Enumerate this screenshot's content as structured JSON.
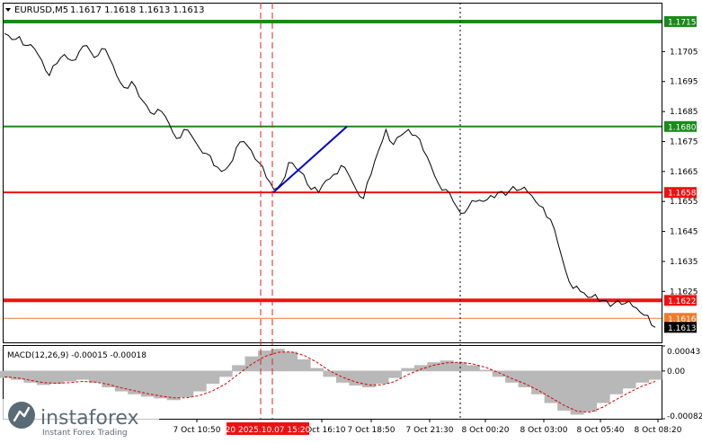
{
  "header": {
    "symbol_label": "EURUSD,M5",
    "ohlc_text": "1.1617 1.1618 1.1613 1.1613"
  },
  "macd_panel": {
    "label": "MACD(12,26,9) -0.00015 -0.00018"
  },
  "watermark": {
    "brand": "instaforex",
    "tagline": "Instant Forex Trading"
  },
  "colors": {
    "price_line": "#000000",
    "green_level": "#1a8a1a",
    "red_level": "#ee1111",
    "orange_level": "#f07a2a",
    "trend_line": "#0000cc",
    "histogram": "#b8b8b8",
    "signal_line": "#dd0000",
    "grid": "#cfcfcf"
  },
  "chart_data": [
    {
      "type": "line",
      "title": "EURUSD,M5",
      "ylim": [
        1.1608,
        1.1721
      ],
      "y_ticks": [
        "1.1705",
        "1.1695",
        "1.1685",
        "1.1675",
        "1.1665",
        "1.1655",
        "1.1645",
        "1.1635",
        "1.1625"
      ],
      "x_tick_labels": [
        "7 Oct 10:50",
        "7 Oct 16:10",
        "7 Oct 18:50",
        "7 Oct 21:30",
        "8 Oct 00:20",
        "8 Oct 03:00",
        "8 Oct 05:40",
        "8 Oct 08:20"
      ],
      "highlighted_time_label": "20 2025.10.07 15:20",
      "series": [
        {
          "values": [
            1.1711,
            1.1709,
            1.171,
            1.1707,
            1.1706,
            1.1702,
            1.1697,
            1.1701,
            1.1704,
            1.1702,
            1.1705,
            1.1707,
            1.1703,
            1.1706,
            1.1703,
            1.1697,
            1.1693,
            1.1695,
            1.169,
            1.1687,
            1.1684,
            1.1685,
            1.1681,
            1.1676,
            1.1679,
            1.1677,
            1.1673,
            1.1671,
            1.1667,
            1.1665,
            1.1667,
            1.1673,
            1.1675,
            1.1672,
            1.1668,
            1.1663,
            1.1659,
            1.1661,
            1.1668,
            1.1666,
            1.1664,
            1.1659,
            1.1658,
            1.1662,
            1.1664,
            1.1667,
            1.1664,
            1.1659,
            1.1656,
            1.1664,
            1.1672,
            1.1679,
            1.1674,
            1.1677,
            1.1679,
            1.1677,
            1.1672,
            1.1667,
            1.1661,
            1.1659,
            1.1655,
            1.1651,
            1.1653,
            1.1655,
            1.1655,
            1.1657,
            1.1658,
            1.1657,
            1.166,
            1.1659,
            1.1658,
            1.1655,
            1.1653,
            1.1649,
            1.1641,
            1.1632,
            1.1626,
            1.1625,
            1.1623,
            1.1624,
            1.1622,
            1.162,
            1.1622,
            1.1621,
            1.162,
            1.1618,
            1.1617,
            1.1613
          ]
        }
      ],
      "horizontal_levels": [
        {
          "label": "1.1715",
          "value": 1.1715,
          "color": "green"
        },
        {
          "label": "1.1680",
          "value": 1.168,
          "color": "green"
        },
        {
          "label": "1.1658",
          "value": 1.1658,
          "color": "red"
        },
        {
          "label": "1.1622",
          "value": 1.1622,
          "color": "red"
        },
        {
          "label": "1.1616",
          "value": 1.1616,
          "color": "orange"
        },
        {
          "label": "1.1613",
          "value": 1.1613,
          "color": "black"
        }
      ],
      "trend_line": {
        "from": 1.1658,
        "to": 1.168
      }
    },
    {
      "type": "bar",
      "title": "MACD(12,26,9) -0.00015 -0.00018",
      "ylim": [
        -0.00082,
        0.00043
      ],
      "y_ticks": [
        "0.00043",
        "0.00",
        "-0.00082"
      ],
      "series": [
        {
          "name": "MACD",
          "values": [
            -0.00012,
            -0.00015,
            -0.0002,
            -0.00024,
            -0.00022,
            -0.00018,
            -0.00015,
            -0.0002,
            -0.00028,
            -0.00035,
            -0.0004,
            -0.00044,
            -0.00047,
            -0.0005,
            -0.00045,
            -0.00035,
            -0.00022,
            -0.0001,
            0.0001,
            0.00025,
            0.00035,
            0.00038,
            0.00033,
            0.0002,
            5e-05,
            -0.0001,
            -0.0002,
            -0.00025,
            -0.00028,
            -0.00022,
            -0.00012,
            5e-05,
            0.0001,
            0.00015,
            0.00018,
            0.00015,
            0.0001,
            2e-05,
            -0.0001,
            -0.0002,
            -0.00028,
            -0.0004,
            -0.00055,
            -0.00068,
            -0.00075,
            -0.0007,
            -0.00055,
            -0.0004,
            -0.0003,
            -0.0002,
            -0.00015
          ]
        },
        {
          "name": "Signal",
          "values": [
            -0.0001,
            -0.00012,
            -0.00016,
            -0.0002,
            -0.00021,
            -0.0002,
            -0.00018,
            -0.00019,
            -0.00023,
            -0.00029,
            -0.00034,
            -0.00039,
            -0.00043,
            -0.00046,
            -0.00046,
            -0.00042,
            -0.00034,
            -0.00022,
            -5e-05,
            0.00012,
            0.00025,
            0.00032,
            0.00033,
            0.00027,
            0.00015,
            0.0,
            -0.00011,
            -0.00019,
            -0.00024,
            -0.00024,
            -0.00018,
            -6e-05,
            3e-05,
            0.0001,
            0.00014,
            0.00015,
            0.00012,
            6e-05,
            -3e-05,
            -0.00013,
            -0.00022,
            -0.00033,
            -0.00046,
            -0.00059,
            -0.00069,
            -0.00071,
            -0.00062,
            -0.00049,
            -0.00037,
            -0.00026,
            -0.00018
          ]
        }
      ]
    }
  ]
}
